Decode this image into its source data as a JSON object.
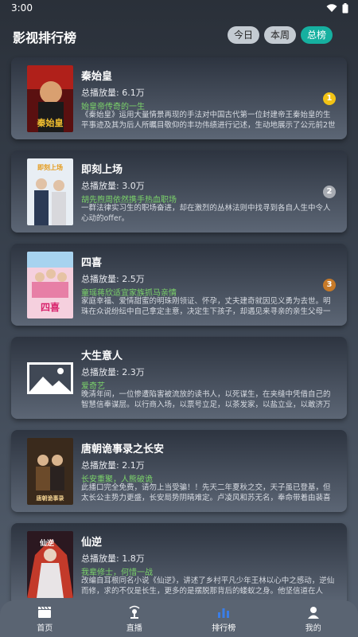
{
  "status": {
    "time": "3:00"
  },
  "header": {
    "title": "影视排行榜",
    "tabs": [
      {
        "label": "今日",
        "active": false
      },
      {
        "label": "本周",
        "active": false
      },
      {
        "label": "总榜",
        "active": true
      }
    ]
  },
  "items": [
    {
      "title": "秦始皇",
      "plays": "总播放量: 6.1万",
      "tagline": "始皇帝传奇的一生",
      "desc": "《秦始皇》运用大量情景再现的手法对中国古代第一位封建帝王秦始皇的生平事迹及其为后人所瞩目敬仰的丰功伟绩进行记述，生动地展示了公元前2世纪中国",
      "rank": "1",
      "poster_text": "秦始皇"
    },
    {
      "title": "即刻上场",
      "plays": "总播放量: 3.0万",
      "tagline": "胡先煦周依然携手热血职场",
      "desc": "一群法律实习生的职场奋进，却在激烈的丛林法则中找寻到各自人生中令人心动的offer。",
      "rank": "2",
      "poster_text": "即刻上场"
    },
    {
      "title": "四喜",
      "plays": "总播放量: 2.5万",
      "tagline": "童瑶蒋欣适宜家族抓马亲情",
      "desc": "家庭幸福、爱情甜蜜的明珠刚领证、怀孕，丈夫建奇就因见义勇为去世。明珠在众说纷纭中自己拿定主意，决定生下孩子，却遇见来寻亲的亲生父母一家。明珠",
      "rank": "3",
      "poster_text": "四喜"
    },
    {
      "title": "大生意人",
      "plays": "总播放量: 2.3万",
      "tagline": "爱奇艺",
      "desc": "晚清年间，一位惨遭陷害被流放的读书人，以死谋生，在夹缝中凭借自己的智慧信奉谋层。以行商入场，以票号立足，以茶发家，以盐立业，以敢济万民，与各商帮交手对抗",
      "rank": "",
      "poster_text": ""
    },
    {
      "title": "唐朝诡事录之长安",
      "plays": "总播放量: 2.1万",
      "tagline": "长安重聚，人熊破诡",
      "desc": "此播口完全免费，请勿上当受骗！！先天二年夏秋之交，天子虽已登基，但太长公主势力更盛，长安局势阴晴难定。卢凌风和苏无名，奉命带着由裴喜君、费鸡师、樱桃和薛环",
      "rank": "",
      "poster_text": "唐朝诡事录"
    },
    {
      "title": "仙逆",
      "plays": "总播放量: 1.8万",
      "tagline": "我辈修士，何惜一战",
      "desc": "改编自耳根同名小说《仙逆》，讲述了乡村平凡少年王林以心中之感动，逆仙而修，求的不仅是长生，更多的是摆脱那背后的蝼蚁之身。他坚信道在人为，以平庸的资质踏入修",
      "rank": "",
      "poster_text": "仙逆"
    }
  ],
  "nav": [
    {
      "label": "首页",
      "icon": "clapperboard-icon",
      "active": false
    },
    {
      "label": "直播",
      "icon": "live-icon",
      "active": false
    },
    {
      "label": "排行榜",
      "icon": "ranking-bars-icon",
      "active": true
    },
    {
      "label": "我的",
      "icon": "user-icon",
      "active": false
    }
  ],
  "colors": {
    "accent": "#16b0a0",
    "tagline": "#7bd36a",
    "gold": "#f2c315",
    "silver": "#a8acb3",
    "bronze": "#c77a28",
    "active_nav": "#3a7ee8"
  }
}
